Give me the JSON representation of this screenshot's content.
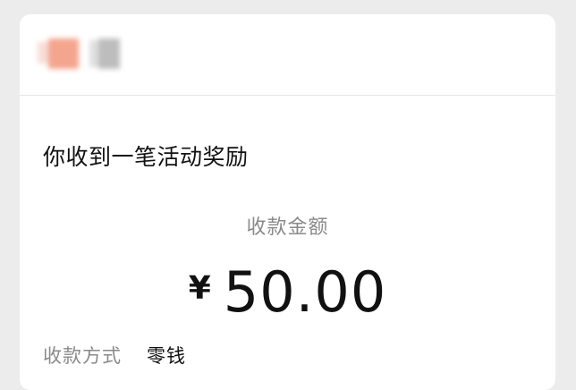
{
  "notice": {
    "title": "你收到一笔活动奖励"
  },
  "amount": {
    "label": "收款金额",
    "currency_symbol": "¥",
    "value": "50.00"
  },
  "details": {
    "method_label": "收款方式",
    "method_value": "零钱"
  },
  "colors": {
    "background": "#ececec",
    "card": "#ffffff",
    "text_primary": "#111111",
    "text_secondary": "#8a8a8a"
  }
}
